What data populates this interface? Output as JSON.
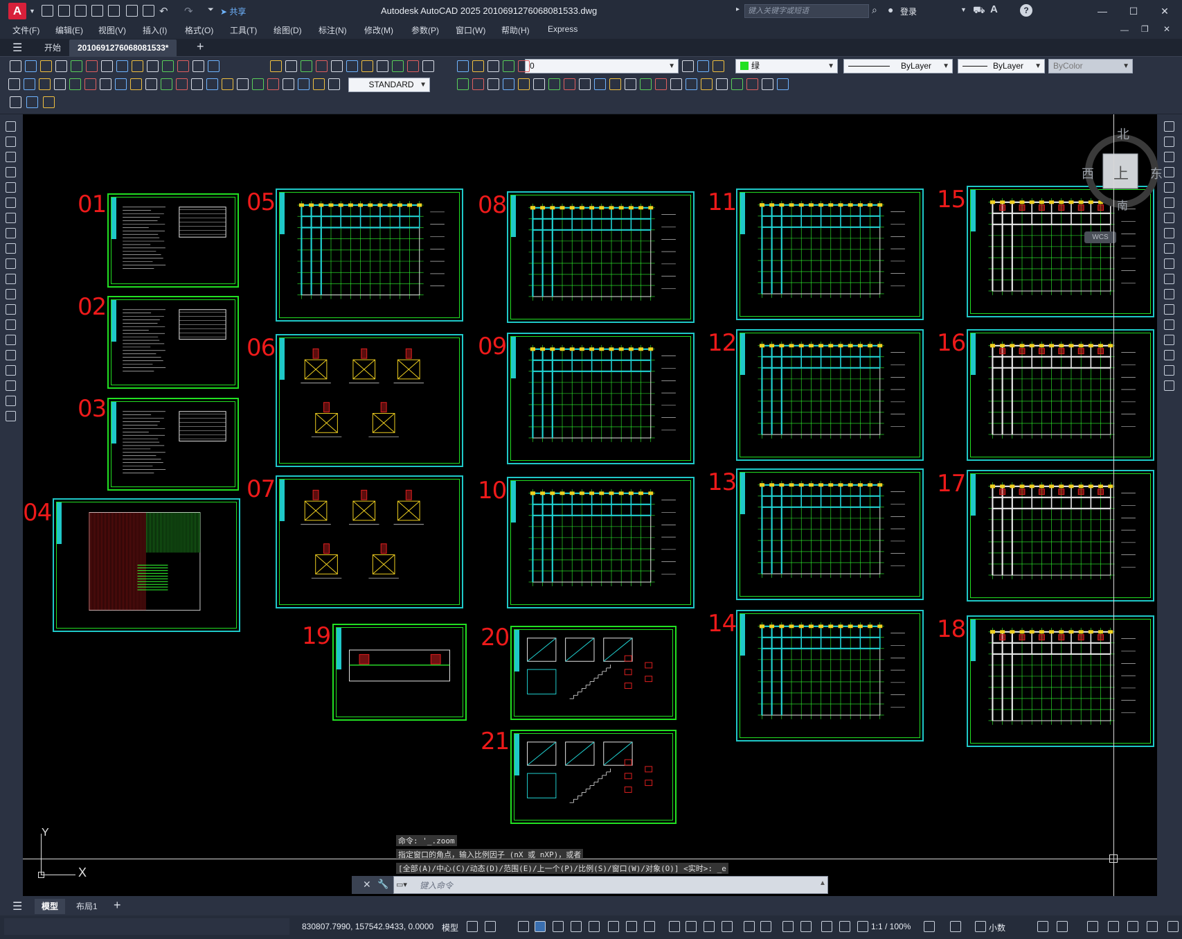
{
  "app": {
    "logo": "A",
    "title": "Autodesk AutoCAD 2025    2010691276068081533.dwg",
    "share_label": "共享",
    "search_placeholder": "键入关键字或短语",
    "login_label": "登录"
  },
  "menu": [
    {
      "label": "文件(F)"
    },
    {
      "label": "编辑(E)"
    },
    {
      "label": "视图(V)"
    },
    {
      "label": "插入(I)"
    },
    {
      "label": "格式(O)"
    },
    {
      "label": "工具(T)"
    },
    {
      "label": "绘图(D)"
    },
    {
      "label": "标注(N)"
    },
    {
      "label": "修改(M)"
    },
    {
      "label": "参数(P)"
    },
    {
      "label": "窗口(W)"
    },
    {
      "label": "帮助(H)"
    },
    {
      "label": "Express"
    }
  ],
  "tabs": {
    "start": "开始",
    "document": "2010691276068081533*"
  },
  "toolbar": {
    "layer_value": "0",
    "color_value": "绿",
    "linetype_value": "ByLayer",
    "lineweight_value": "ByLayer",
    "plotstyle_value": "ByColor",
    "textstyle_value": "STANDARD"
  },
  "viewcube": {
    "north": "北",
    "south": "南",
    "east": "东",
    "west": "西",
    "top_face": "上",
    "wcs": "WCS"
  },
  "sheets": [
    "01",
    "02",
    "03",
    "04",
    "05",
    "06",
    "07",
    "08",
    "09",
    "10",
    "11",
    "12",
    "13",
    "14",
    "15",
    "16",
    "17",
    "18",
    "19",
    "20",
    "21"
  ],
  "ucs": {
    "y": "Y",
    "x": "X"
  },
  "command": {
    "history": [
      "命令: '_.zoom",
      "指定窗口的角点，输入比例因子 (nX 或 nXP)，或者",
      "[全部(A)/中心(C)/动态(D)/范围(E)/上一个(P)/比例(S)/窗口(W)/对象(O)] <实时>: _e"
    ],
    "placeholder": "键入命令"
  },
  "layout_tabs": {
    "model": "模型",
    "layout1": "布局1"
  },
  "status": {
    "coords": "830807.7990, 157542.9433, 0.0000",
    "model_label": "模型",
    "scale": "1:1 / 100%",
    "units": "小数"
  },
  "colors": {
    "sheet_cyan": "#1fc8c8",
    "sheet_green": "#22e022",
    "sheet_number_red": "#ee1a1a",
    "canvas_bg": "#000000"
  }
}
